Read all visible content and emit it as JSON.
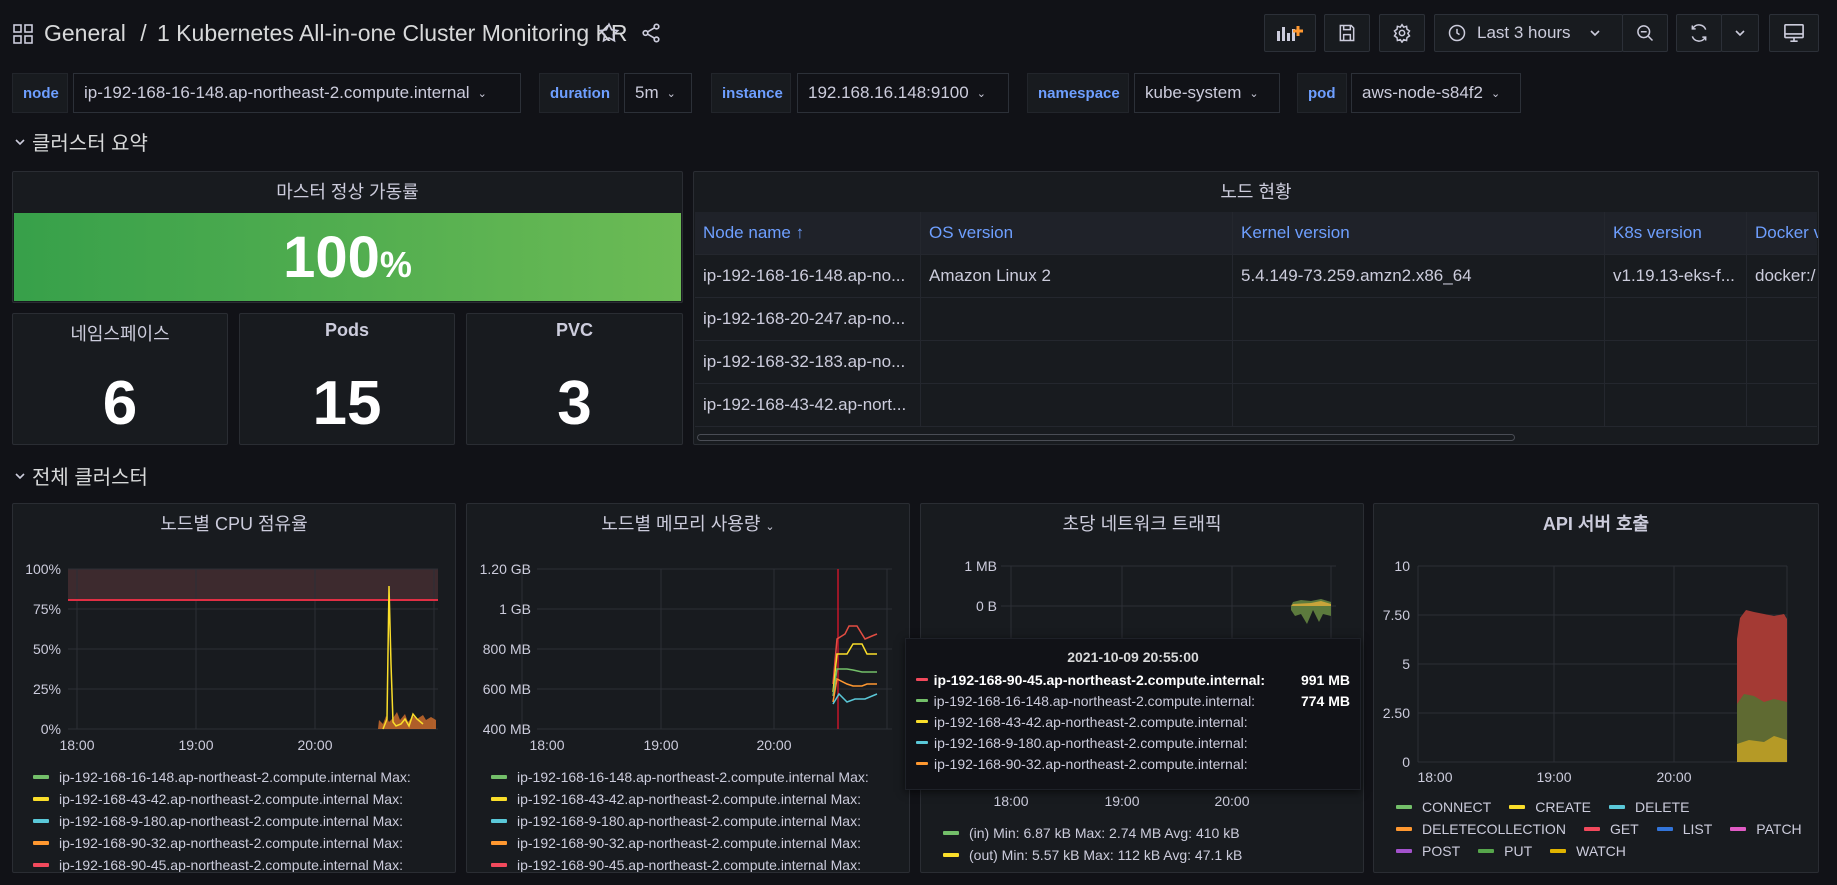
{
  "header": {
    "folder": "General",
    "separator": "/",
    "dashboard": "1 Kubernetes All-in-one Cluster Monitoring KR",
    "time_range": "Last 3 hours"
  },
  "variables": [
    {
      "label": "node",
      "value": "ip-192-168-16-148.ap-northeast-2.compute.internal"
    },
    {
      "label": "duration",
      "value": "5m"
    },
    {
      "label": "instance",
      "value": "192.168.16.148:9100"
    },
    {
      "label": "namespace",
      "value": "kube-system"
    },
    {
      "label": "pod",
      "value": "aws-node-s84f2"
    }
  ],
  "rows": {
    "summary": "클러스터 요약",
    "overall": "전체 클러스터"
  },
  "uptime": {
    "title": "마스터 정상 가동률",
    "value": "100",
    "unit": "%"
  },
  "stats": [
    {
      "title": "네임스페이스",
      "value": "6"
    },
    {
      "title": "Pods",
      "value": "15"
    },
    {
      "title": "PVC",
      "value": "3"
    }
  ],
  "nodes_table": {
    "title": "노드 현황",
    "headers": [
      "Node name ↑",
      "OS version",
      "Kernel version",
      "K8s version",
      "Docker v"
    ],
    "rows": [
      [
        "ip-192-168-16-148.ap-no...",
        "Amazon Linux 2",
        "5.4.149-73.259.amzn2.x86_64",
        "v1.19.13-eks-f...",
        "docker:/"
      ],
      [
        "ip-192-168-20-247.ap-no...",
        "",
        "",
        "",
        ""
      ],
      [
        "ip-192-168-32-183.ap-no...",
        "",
        "",
        "",
        ""
      ],
      [
        "ip-192-168-43-42.ap-nort...",
        "",
        "",
        "",
        ""
      ]
    ]
  },
  "panels": {
    "cpu": "노드별 CPU 점유율",
    "mem": "노드별 메모리 사용량",
    "net": "초당 네트워크 트래픽",
    "api": "API 서버 호출"
  },
  "colors": {
    "green": "#73bf69",
    "yellow": "#fade2a",
    "cyan": "#5794f2",
    "orange": "#ff9830",
    "red": "#f2495c",
    "blue": "#3274d9",
    "purple": "#a352cc",
    "pink": "#e05bc4"
  },
  "chart_data": [
    {
      "type": "line",
      "title": "노드별 CPU 점유율",
      "x": [
        "18:00",
        "19:00",
        "20:00"
      ],
      "yticks": [
        "100%",
        "75%",
        "50%",
        "25%",
        "0%"
      ],
      "ylim": [
        0,
        100
      ],
      "threshold": 80,
      "series": [
        {
          "name": "ip-192-168-16-148.ap-northeast-2.compute.internal",
          "legend": "ip-192-168-16-148.ap-northeast-2.compute.internal  Max:"
        },
        {
          "name": "ip-192-168-43-42.ap-northeast-2.compute.internal",
          "legend": "ip-192-168-43-42.ap-northeast-2.compute.internal  Max:"
        },
        {
          "name": "ip-192-168-9-180.ap-northeast-2.compute.internal",
          "legend": "ip-192-168-9-180.ap-northeast-2.compute.internal  Max:"
        },
        {
          "name": "ip-192-168-90-32.ap-northeast-2.compute.internal",
          "legend": "ip-192-168-90-32.ap-northeast-2.compute.internal  Max:"
        },
        {
          "name": "ip-192-168-90-45.ap-northeast-2.compute.internal",
          "legend": "ip-192-168-90-45.ap-northeast-2.compute.internal  Max:"
        }
      ]
    },
    {
      "type": "line",
      "title": "노드별 메모리 사용량",
      "x": [
        "18:00",
        "19:00",
        "20:00"
      ],
      "yticks": [
        "1.20 GB",
        "1 GB",
        "800 MB",
        "600 MB",
        "400 MB"
      ],
      "series": [
        {
          "legend": "ip-192-168-16-148.ap-northeast-2.compute.internal  Max:"
        },
        {
          "legend": "ip-192-168-43-42.ap-northeast-2.compute.internal  Max:"
        },
        {
          "legend": "ip-192-168-9-180.ap-northeast-2.compute.internal  Max:"
        },
        {
          "legend": "ip-192-168-90-32.ap-northeast-2.compute.internal  Max:"
        },
        {
          "legend": "ip-192-168-90-45.ap-northeast-2.compute.internal  Max:"
        }
      ]
    },
    {
      "type": "area",
      "title": "초당 네트워크 트래픽",
      "x": [
        "18:00",
        "19:00",
        "20:00"
      ],
      "yticks": [
        "1 MB",
        "0 B"
      ],
      "series": [
        {
          "name": "(in)",
          "legend": "(in)  Min: 6.87 kB  Max: 2.74 MB  Avg: 410 kB"
        },
        {
          "name": "(out)",
          "legend": "(out)  Min: 5.57 kB  Max: 112 kB  Avg: 47.1 kB"
        }
      ]
    },
    {
      "type": "area",
      "title": "API 서버 호출",
      "x": [
        "18:00",
        "19:00",
        "20:00"
      ],
      "yticks": [
        "10",
        "7.50",
        "5",
        "2.50",
        "0"
      ],
      "ylim": [
        0,
        10
      ],
      "series": [
        {
          "name": "CONNECT"
        },
        {
          "name": "CREATE"
        },
        {
          "name": "DELETE"
        },
        {
          "name": "DELETECOLLECTION"
        },
        {
          "name": "GET"
        },
        {
          "name": "LIST"
        },
        {
          "name": "PATCH"
        },
        {
          "name": "POST"
        },
        {
          "name": "PUT"
        },
        {
          "name": "WATCH"
        }
      ]
    }
  ],
  "tooltip": {
    "time": "2021-10-09 20:55:00",
    "items": [
      {
        "label": "ip-192-168-90-45.ap-northeast-2.compute.internal:",
        "value": "991 MB"
      },
      {
        "label": "ip-192-168-16-148.ap-northeast-2.compute.internal:",
        "value": "774 MB"
      },
      {
        "label": "ip-192-168-43-42.ap-northeast-2.compute.internal:",
        "value": ""
      },
      {
        "label": "ip-192-168-9-180.ap-northeast-2.compute.internal:",
        "value": ""
      },
      {
        "label": "ip-192-168-90-32.ap-northeast-2.compute.internal:",
        "value": ""
      }
    ]
  }
}
